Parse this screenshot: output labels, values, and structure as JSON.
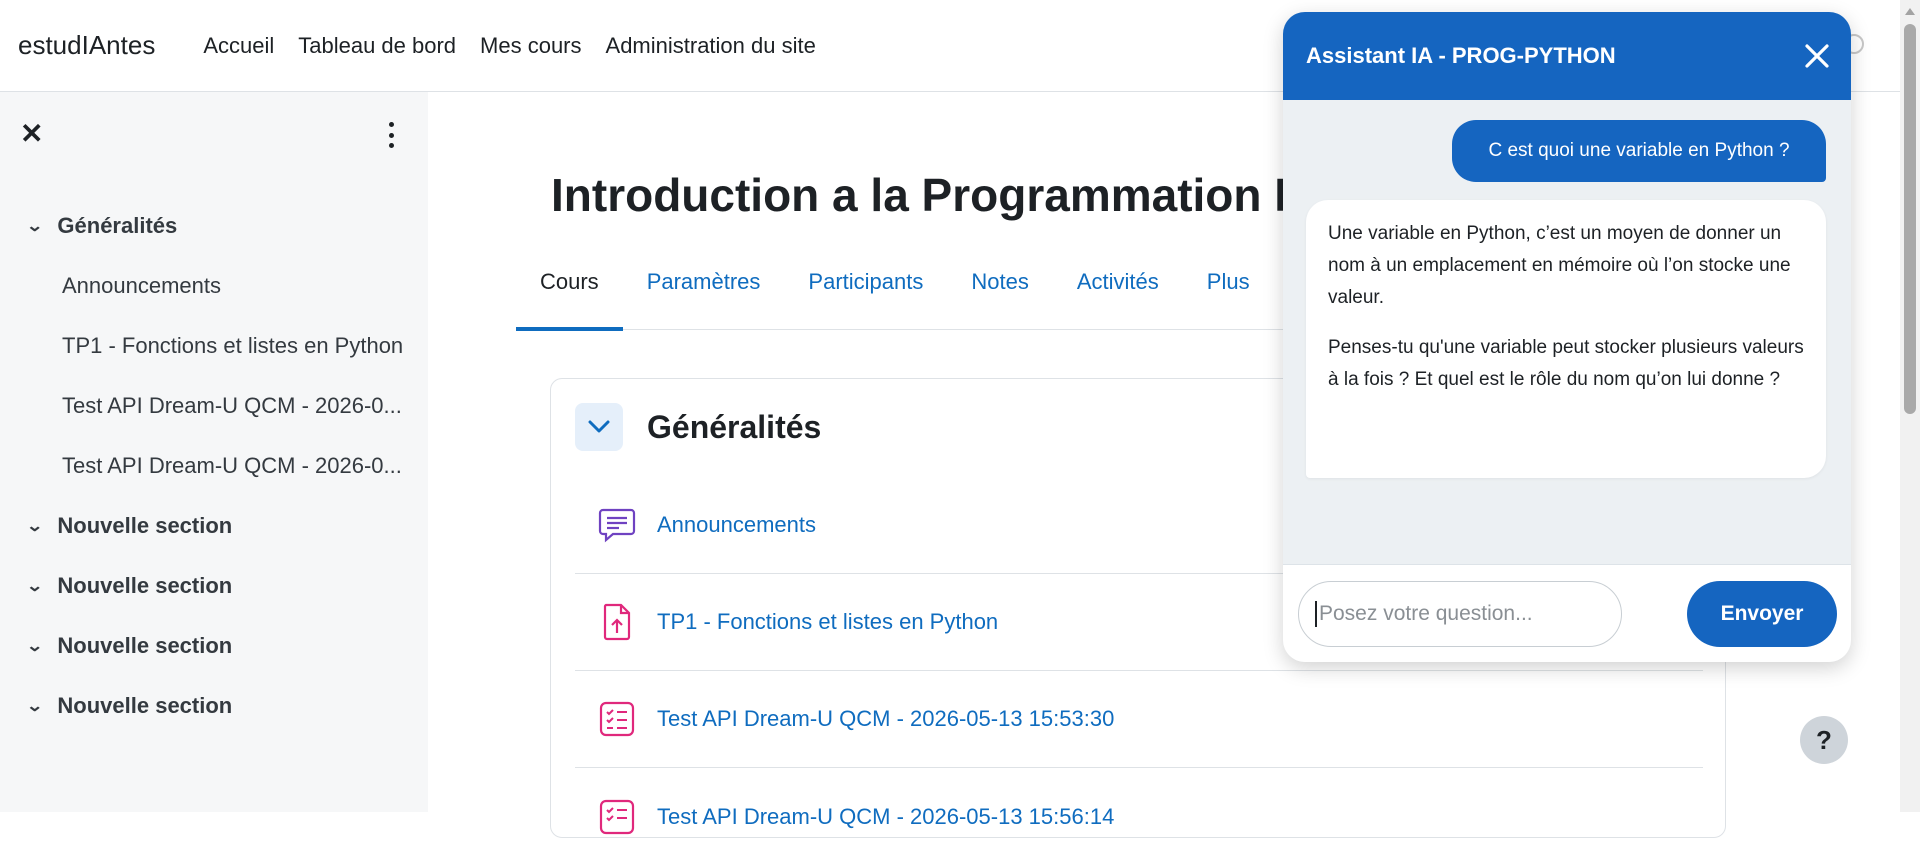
{
  "navbar": {
    "brand": "estudIAntes",
    "links": [
      "Accueil",
      "Tableau de bord",
      "Mes cours",
      "Administration du site"
    ]
  },
  "drawer": {
    "close_icon": "close-icon",
    "more_icon": "kebab-icon",
    "sections": [
      {
        "label": "Généralités",
        "expanded": true
      },
      {
        "label": "Nouvelle section",
        "expanded": true
      },
      {
        "label": "Nouvelle section",
        "expanded": true
      },
      {
        "label": "Nouvelle section",
        "expanded": true
      },
      {
        "label": "Nouvelle section",
        "expanded": true
      }
    ],
    "items": [
      "Announcements",
      "TP1 - Fonctions et listes en Python",
      "Test API Dream-U QCM - 2026-0...",
      "Test API Dream-U QCM - 2026-0..."
    ]
  },
  "course": {
    "title": "Introduction a la Programmation P",
    "tabs": [
      "Cours",
      "Paramètres",
      "Participants",
      "Notes",
      "Activités",
      "Plus"
    ],
    "active_tab": "Cours",
    "section_title": "Généralités",
    "activities": [
      {
        "label": "Announcements",
        "icon": "forum-icon",
        "color": "#6f42c1"
      },
      {
        "label": "TP1 - Fonctions et listes en Python",
        "icon": "assignment-upload-icon",
        "color": "#e0287c"
      },
      {
        "label": "Test API Dream-U QCM - 2026-05-13 15:53:30",
        "icon": "quiz-icon",
        "color": "#e0287c"
      },
      {
        "label": "Test API Dream-U QCM - 2026-05-13 15:56:14",
        "icon": "quiz-icon",
        "color": "#e0287c"
      }
    ]
  },
  "help": {
    "label": "?"
  },
  "chat": {
    "title": "Assistant IA - PROG-PYTHON",
    "user_message": "C est quoi une variable en Python ?",
    "bot_message_p1": "Une variable en Python, c’est un moyen de donner un nom à un emplacement en mémoire où l’on stocke une valeur.",
    "bot_message_p2": "Penses-tu qu'une variable peut stocker plusieurs valeurs à la fois ? Et quel est le rôle du nom qu’on lui donne ?",
    "input_placeholder": "Posez votre question...",
    "send_label": "Envoyer"
  },
  "colors": {
    "accent": "#0f6cbf",
    "chat_blue": "#1565c0",
    "forum_purple": "#6f42c1",
    "activity_pink": "#e0287c"
  }
}
